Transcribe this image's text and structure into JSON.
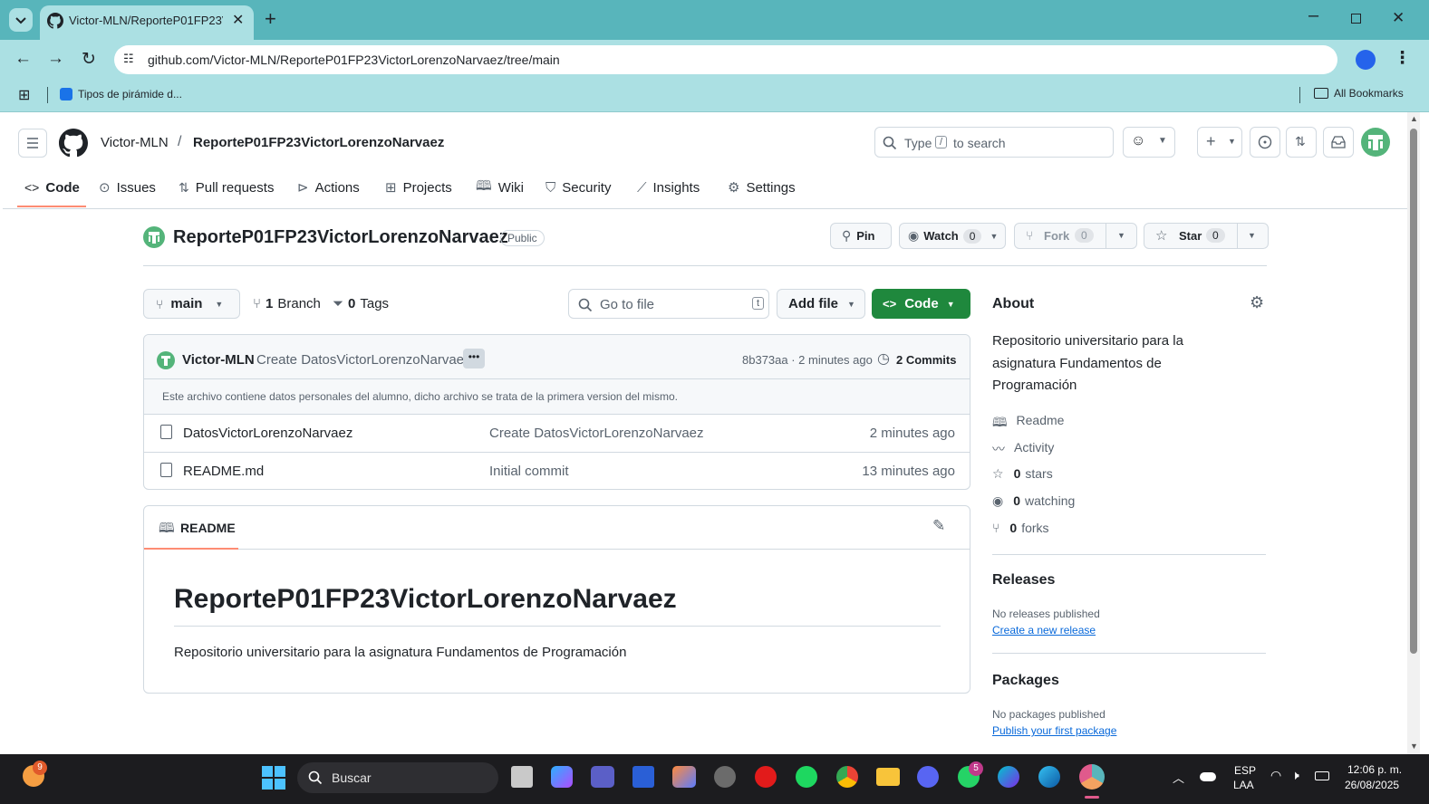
{
  "browser": {
    "tab_title": "Victor-MLN/ReporteP01FP23Vi",
    "url": "github.com/Victor-MLN/ReporteP01FP23VictorLorenzoNarvaez/tree/main",
    "bookmark_1": "Tipos de pirámide d...",
    "all_bookmarks": "All Bookmarks",
    "theme_color": "#58b5bb"
  },
  "github": {
    "owner": "Victor-MLN",
    "separator": "/",
    "repo": "ReporteP01FP23VictorLorenzoNarvaez",
    "search_pre": "Type",
    "search_key": "/",
    "search_post": "to search",
    "nav": [
      {
        "label": "Code",
        "icon": "code-icon"
      },
      {
        "label": "Issues",
        "icon": "issue-icon"
      },
      {
        "label": "Pull requests",
        "icon": "pull-request-icon"
      },
      {
        "label": "Actions",
        "icon": "play-icon"
      },
      {
        "label": "Projects",
        "icon": "table-icon"
      },
      {
        "label": "Wiki",
        "icon": "book-icon"
      },
      {
        "label": "Security",
        "icon": "shield-icon"
      },
      {
        "label": "Insights",
        "icon": "graph-icon"
      },
      {
        "label": "Settings",
        "icon": "gear-icon"
      }
    ],
    "visibility": "Public",
    "pin": "Pin",
    "watch": "Watch",
    "watch_count": "0",
    "fork": "Fork",
    "fork_count": "0",
    "star": "Star",
    "star_count": "0",
    "branch": "main",
    "branch_count": "1",
    "branch_label": "Branch",
    "tag_count": "0",
    "tag_label": "Tags",
    "goto_file": "Go to file",
    "goto_key": "t",
    "add_file": "Add file",
    "code_button": "Code",
    "accent_green": "#1f883d",
    "commit": {
      "author": "Victor-MLN",
      "message": "Create DatosVictorLorenzoNarvaez",
      "hash_time": "8b373aa · 2 minutes ago",
      "commits": "2 Commits",
      "description": "Este archivo contiene datos personales del alumno, dicho archivo se trata de la primera version del mismo."
    },
    "files": [
      {
        "name": "DatosVictorLorenzoNarvaez",
        "message": "Create DatosVictorLorenzoNarvaez",
        "time": "2 minutes ago"
      },
      {
        "name": "README.md",
        "message": "Initial commit",
        "time": "13 minutes ago"
      }
    ],
    "readme": {
      "tab": "README",
      "heading": "ReporteP01FP23VictorLorenzoNarvaez",
      "body": "Repositorio universitario para la asignatura Fundamentos de Programación"
    },
    "about": {
      "title": "About",
      "description": "Repositorio universitario para la asignatura Fundamentos de Programación",
      "readme": "Readme",
      "activity": "Activity",
      "stars_n": "0",
      "stars": "stars",
      "watching_n": "0",
      "watching": "watching",
      "forks_n": "0",
      "forks": "forks"
    },
    "releases": {
      "title": "Releases",
      "none": "No releases published",
      "link": "Create a new release"
    },
    "packages": {
      "title": "Packages",
      "none": "No packages published",
      "link": "Publish your first package"
    }
  },
  "taskbar": {
    "search": "Buscar",
    "lang1": "ESP",
    "lang2": "LAA",
    "time": "12:06 p. m.",
    "date": "26/08/2025",
    "badge_left": "9",
    "badge_whatsapp": "5"
  }
}
